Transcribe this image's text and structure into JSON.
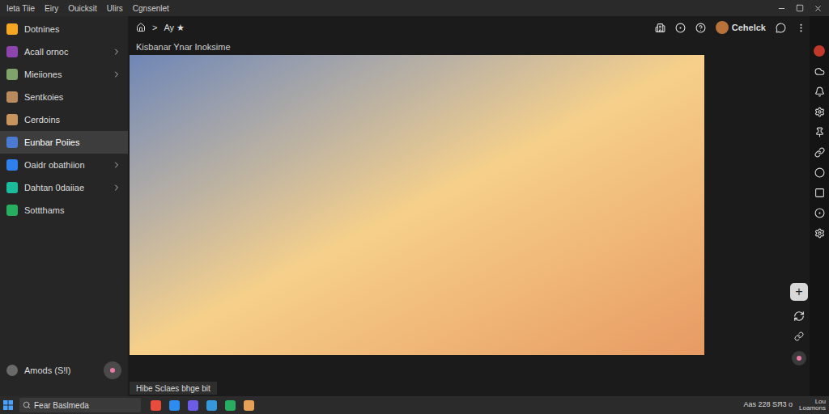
{
  "window": {
    "menu": [
      "Ieta Tiie",
      "Eiry",
      "Ouicksit",
      "Ulirs",
      "Cgnsenlet"
    ]
  },
  "sidebar": {
    "items": [
      {
        "label": "Dotnines",
        "color": "#f5a623",
        "expandable": false,
        "selected": false
      },
      {
        "label": "Acall ornoc",
        "color": "#8e44ad",
        "expandable": true,
        "selected": false
      },
      {
        "label": "Mieiiones",
        "color": "#7fa36b",
        "expandable": true,
        "selected": false
      },
      {
        "label": "Sentkoies",
        "color": "#b98a5e",
        "expandable": false,
        "selected": false
      },
      {
        "label": "Cerdoins",
        "color": "#c9955f",
        "expandable": false,
        "selected": false
      },
      {
        "label": "Eunbar Poiies",
        "color": "#4a7bd0",
        "expandable": false,
        "selected": true
      },
      {
        "label": "Oaidr obathiion",
        "color": "#2f80ed",
        "expandable": true,
        "selected": false
      },
      {
        "label": "Dahtan 0daiiae",
        "color": "#1abc9c",
        "expandable": true,
        "selected": false
      },
      {
        "label": "Sottthams",
        "color": "#27ae60",
        "expandable": false,
        "selected": false
      }
    ],
    "footer": {
      "label": "Amods (S!l)"
    }
  },
  "breadcrumb": {
    "separator": ">",
    "items": [
      "Ay ★"
    ]
  },
  "toolbar": {
    "user": "Cehelck"
  },
  "page": {
    "title": "Kisbanar Ynar Inoksime",
    "caption": "Hibe Sclaes bhge bit"
  },
  "float_buttons": {
    "add": "+"
  },
  "taskbar": {
    "search": "Fear Baslmeda",
    "apps": [
      {
        "color": "#e74c3c"
      },
      {
        "color": "#2d8cf0"
      },
      {
        "color": "#6c5ce7"
      },
      {
        "color": "#3498db"
      },
      {
        "color": "#27ae60"
      },
      {
        "color": "#e6a157"
      }
    ],
    "tray": "Aas 228 SЯ3 o",
    "clock": [
      "Lou",
      "Loamons"
    ]
  }
}
